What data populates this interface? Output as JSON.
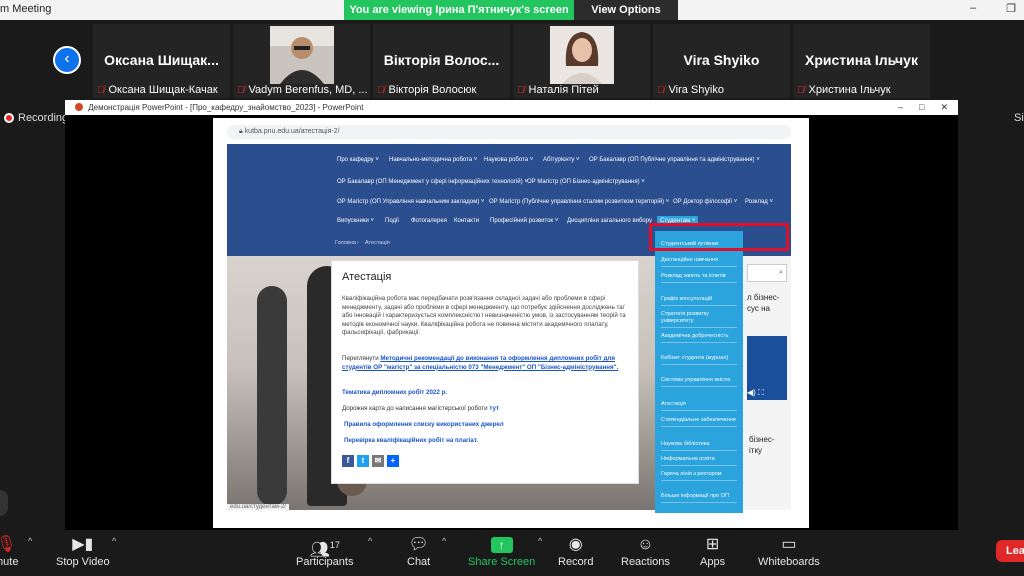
{
  "window": {
    "title": "m Meeting",
    "share_banner": "You are viewing Ірина П'ятничук's screen",
    "view_options": "View Options",
    "minimize_icon": "–",
    "restore_icon": "❐"
  },
  "participants": [
    {
      "big": "Оксана Шищак...",
      "name": "Оксана Шищак-Качак"
    },
    {
      "big": "",
      "name": "Vadym Berenfus, MD, ..."
    },
    {
      "big": "Вікторія Волос...",
      "name": "Вікторія Волосюк"
    },
    {
      "big": "",
      "name": "Наталія Пітей"
    },
    {
      "big": "Vira Shyiko",
      "name": "Vira Shyiko"
    },
    {
      "big": "Христина Ільчук",
      "name": "Христина Ільчук"
    }
  ],
  "recording_label": "Recording",
  "right_cut": "Si",
  "ppt": {
    "title": "Демонстрація PowerPoint - [Про_кафедру_знайомство_2023] - PowerPoint",
    "min": "–",
    "max": "□",
    "close": "✕"
  },
  "slide": {
    "url": "kutba.pnu.edu.ua/атестація-2/",
    "nav": {
      "row1": [
        "Про кафедру ˅",
        "Навчально-методична робота ˅",
        "Наукова робота ˅",
        "Абітурієнту ˅",
        "ОР Бакалавр (ОП Публічне управління та адміністрування) ˅"
      ],
      "row2": [
        "ОР Бакалавр (ОП Менеджмент у сфері інформаційних технологій) ˅",
        "ОР Магістр (ОП Бізнес-адміністрування) ˅"
      ],
      "row3": [
        "ОР Магістр (ОП Управління навчальним закладом) ˅",
        "ОР Магістр (Публічне управління сталим розвитком територій) ˅",
        "ОР Доктор філософії ˅",
        "Розклад ˅"
      ],
      "row4": [
        "Випускники ˅",
        "Події",
        "Фотогалерея",
        "Контакти",
        "Професійний розвиток ˅",
        "Дисципліни загального вибору",
        "Студентам ˅"
      ],
      "breadcrumb": [
        "Головна",
        "›",
        "Атестація"
      ]
    },
    "card": {
      "title": "Атестація",
      "body": "Кваліфікаційна робота має передбачати розв'язання складної задачі або проблеми в сфері менеджменту, задачі або проблеми в сфері менеджменту, що потребує здійснення досліджень та/або інновацій і характеризується комплексністю і невизначеністю умов, із застосуванням теорій та методів економічної науки. Кваліфікаційна робота не повинна містити академічного плагіату, фальсифікації, фабрикації.",
      "review_prefix": "Переглянути",
      "review_link": "Методичні рекомендації до виконання та оформлення дипломних робіт для студентів ОР \"магістр\" за спеціальністю 073 \"Менеджмент\" ОП \"Бізнес-адміністрування\".",
      "thematic": "Тематика дипломних робіт 2022 р.",
      "roadmap_prefix": "Дорожня карта до написання магістерської роботи",
      "roadmap_link": "тут",
      "rules": "Правила оформлення списку використаних джерел",
      "check": "Перевірка кваліфікаційних робіт на плагіат.",
      "social": [
        {
          "icon": "facebook-icon",
          "glyph": "f",
          "color": "#3b5998"
        },
        {
          "icon": "twitter-icon",
          "glyph": "t",
          "color": "#1da1f2"
        },
        {
          "icon": "email-icon",
          "glyph": "✉",
          "color": "#777777"
        },
        {
          "icon": "share-icon",
          "glyph": "+",
          "color": "#0166ff"
        }
      ]
    },
    "dropdown": [
      "Студентський путівник",
      "Дистанційне навчання",
      "Розклад занять та іспитів",
      "Графік консультацій",
      "Стратегія розвитку університету",
      "Академічна доброчесність",
      "Кабінет студента (журнал)",
      "Система управління якістю",
      "Атестація",
      "Стипендіальне забезпечення",
      "Наукова бібліотека",
      "Неформальна освіта",
      "Гаряча лінія з ректором",
      "Більше інформації про ОП"
    ],
    "sidebar": {
      "search_icon": "⌕",
      "text1": "л бізнес-\nсус на",
      "controls": "◀) ⛶",
      "text2": "бізнес-\nітку"
    },
    "status_url": "edu.ua/студентам-2/"
  },
  "toolbar": {
    "mute": "mute",
    "stop_video": "Stop Video",
    "participants": "Participants",
    "participants_count": "17",
    "chat": "Chat",
    "share_screen": "Share Screen",
    "record": "Record",
    "reactions": "Reactions",
    "apps": "Apps",
    "whiteboards": "Whiteboards",
    "leave": "Lea"
  }
}
